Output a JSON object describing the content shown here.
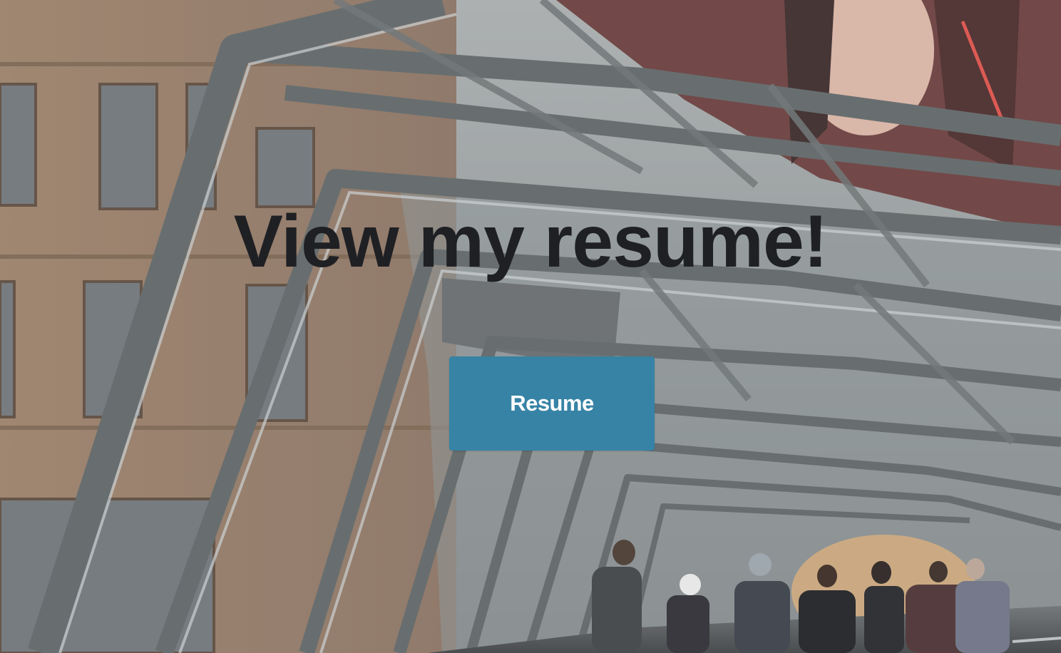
{
  "hero": {
    "title": "View my resume!",
    "background_icon": "glass-walkway-photo-icon"
  },
  "resume_button": {
    "label": "Resume"
  },
  "colors": {
    "title_text": "#1f2024",
    "button_background": "#3783a5",
    "button_text": "#ffffff"
  }
}
